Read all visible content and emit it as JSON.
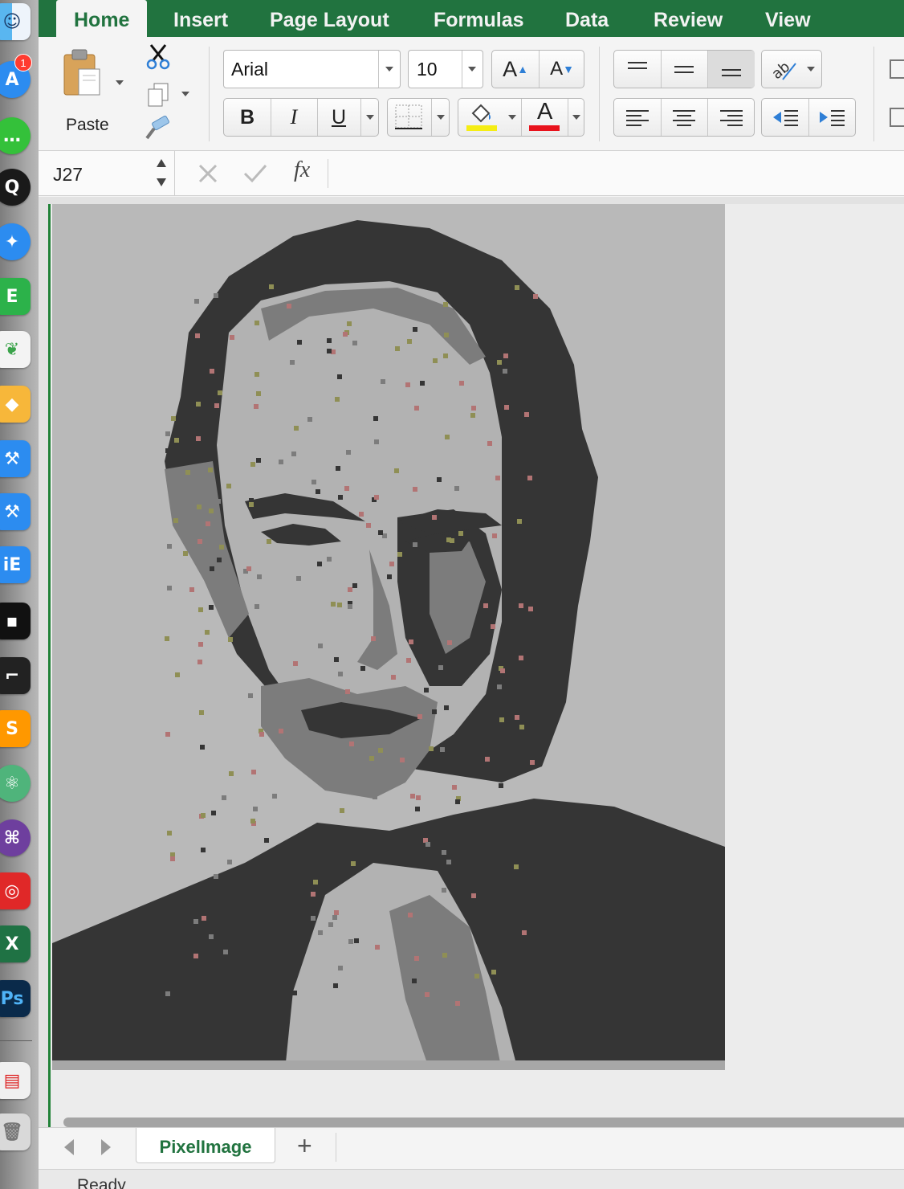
{
  "dock": {
    "appstore_badge": "1",
    "icons": [
      "finder-icon",
      "app-store-icon",
      "wechat-icon",
      "qq-icon",
      "safari-icon",
      "evernote-icon",
      "pixelmator-icon",
      "sketch-icon",
      "xcode-icon",
      "xcode-beta-icon",
      "instruments-icon",
      "terminal-icon",
      "console-icon",
      "sublime-text-icon",
      "atom-icon",
      "github-desktop-icon",
      "netease-music-icon",
      "excel-icon",
      "photoshop-icon",
      "downloads-stack-icon",
      "trash-icon"
    ]
  },
  "ribbon": {
    "tabs": [
      "Home",
      "Insert",
      "Page Layout",
      "Formulas",
      "Data",
      "Review",
      "View"
    ],
    "active_tab": "Home",
    "paste_label": "Paste",
    "font_name": "Arial",
    "font_size": "10",
    "bold_label": "B",
    "italic_label": "I",
    "underline_label": "U",
    "font_color_label": "A",
    "grow_font_label": "A",
    "shrink_font_label": "A",
    "fill_color": "#f5ed14",
    "font_color": "#e8121c"
  },
  "formula_bar": {
    "name_box": "J27",
    "fx_label": "fx",
    "formula_value": ""
  },
  "sheet": {
    "tabs": [
      "PixelImage"
    ],
    "active_sheet": "PixelImage",
    "add_sheet_label": "+",
    "status": "Ready",
    "palette": {
      "background": "#b9b9b9",
      "light": "#b2b2b2",
      "mid": "#7c7c7c",
      "dark": "#353535",
      "accent_red": "#b27474",
      "accent_olive": "#8f8f55"
    }
  },
  "colors": {
    "excel_green": "#21733f",
    "selection_green": "#218238"
  }
}
